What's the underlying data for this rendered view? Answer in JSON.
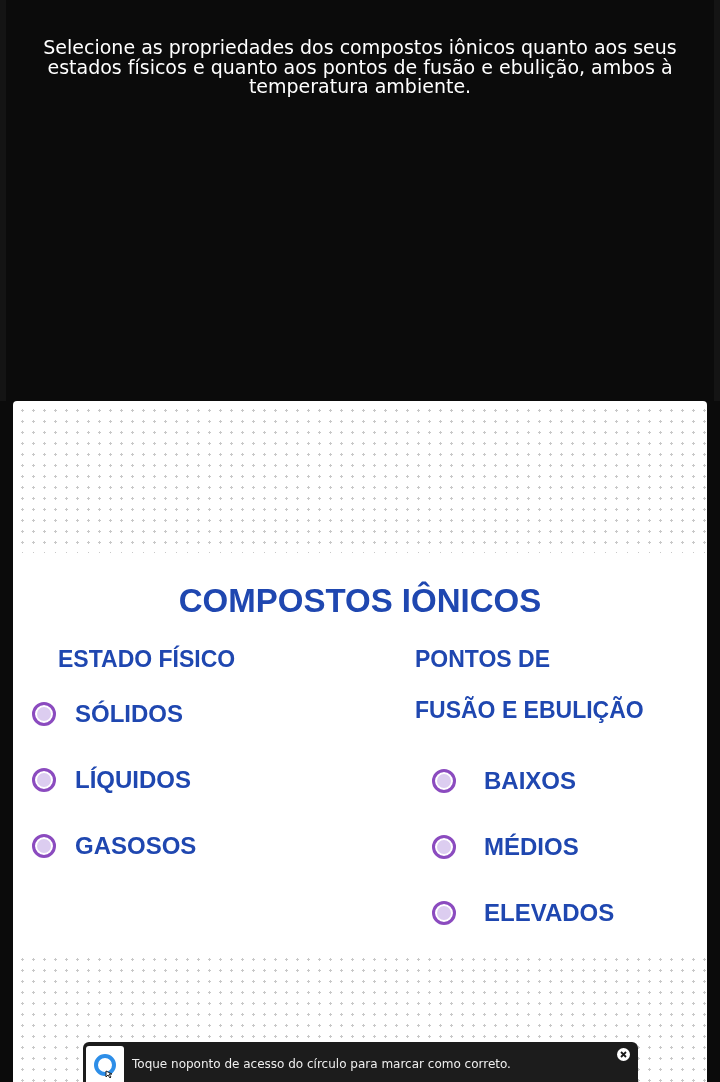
{
  "question": "Selecione as propriedades dos compostos iônicos quanto aos seus estados físicos e quanto aos pontos de fusão e ebulição, ambos à temperatura ambiente.",
  "image": {
    "title": "COMPOSTOS IÔNICOS",
    "columns": [
      {
        "heading": [
          "ESTADO FÍSICO"
        ],
        "options": [
          {
            "label": "SÓLIDOS",
            "selected": false
          },
          {
            "label": "LÍQUIDOS",
            "selected": false
          },
          {
            "label": "GASOSOS",
            "selected": false
          }
        ]
      },
      {
        "heading": [
          "PONTOS DE",
          "FUSÃO E EBULIÇÃO"
        ],
        "options": [
          {
            "label": "BAIXOS",
            "selected": false
          },
          {
            "label": "MÉDIOS",
            "selected": false
          },
          {
            "label": "ELEVADOS",
            "selected": false
          }
        ]
      }
    ]
  },
  "toast": {
    "message": "Toque noponto de acesso do círculo para marcar como correto."
  }
}
